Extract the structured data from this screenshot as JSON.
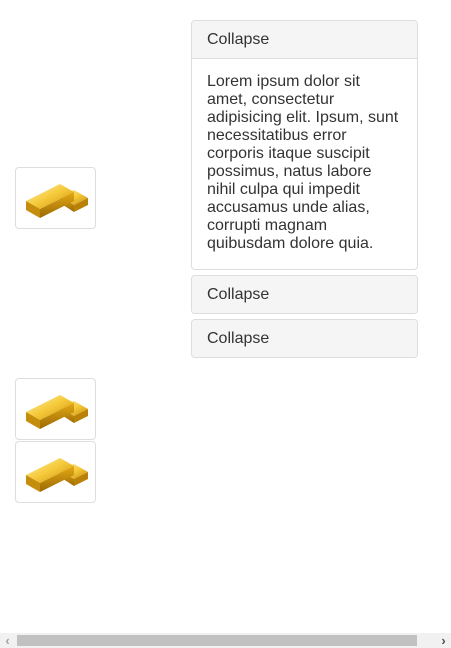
{
  "thumbnails": [
    {
      "icon": "gold-bars-icon"
    },
    {
      "icon": "gold-bars-icon"
    },
    {
      "icon": "gold-bars-icon"
    }
  ],
  "accordion": {
    "panels": [
      {
        "heading": "Collapse",
        "expanded": true,
        "body": "Lorem ipsum dolor sit amet, consectetur adipisicing elit. Ipsum, sunt necessitatibus error corporis itaque suscipit possimus, natus labore nihil culpa qui impedit accusamus unde alias, corrupti magnam quibusdam dolore quia."
      },
      {
        "heading": "Collapse",
        "expanded": false
      },
      {
        "heading": "Collapse",
        "expanded": false
      }
    ]
  },
  "scrollbar": {
    "left_arrow": "‹",
    "right_arrow": "›"
  },
  "colors": {
    "panel_border": "#dddddd",
    "panel_heading_bg": "#f5f5f5",
    "text": "#333333",
    "gold": "#f2c12e"
  }
}
